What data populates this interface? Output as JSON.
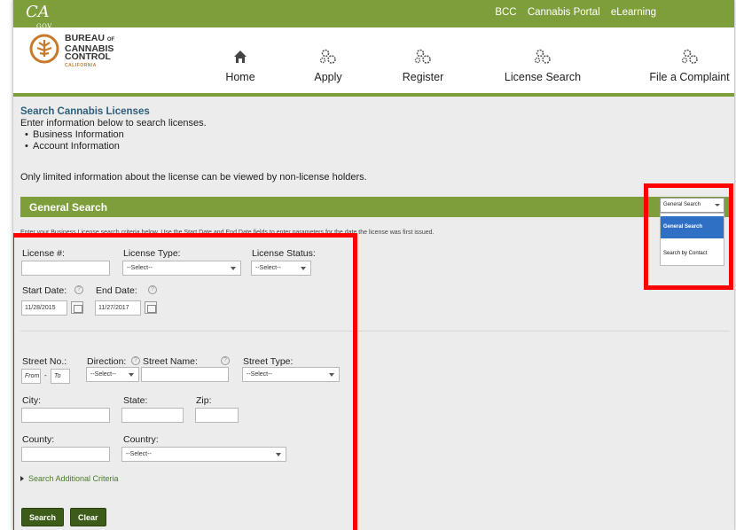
{
  "topbar": {
    "logo_text": "CA",
    "logo_sub": "GOV",
    "links": [
      "BCC",
      "Cannabis Portal",
      "eLearning"
    ]
  },
  "brand": {
    "line1": "BUREAU",
    "of": "OF",
    "line2": "CANNABIS",
    "line3": "CONTROL",
    "state": "CALIFORNIA"
  },
  "nav": [
    {
      "label": "Home",
      "icon": "home-icon"
    },
    {
      "label": "Apply",
      "icon": "gears-icon"
    },
    {
      "label": "Register",
      "icon": "gears-icon"
    },
    {
      "label": "License Search",
      "icon": "gears-icon"
    },
    {
      "label": "File a Complaint",
      "icon": "gears-icon"
    }
  ],
  "intro": {
    "title": "Search Cannabis Licenses",
    "text": "Enter information below to search licenses.",
    "bullets": [
      "Business Information",
      "Account Information"
    ],
    "notice": "Only limited information about the license can be viewed by non-license holders."
  },
  "general_search": {
    "title": "General Search",
    "subtitle": "Enter your Business License search criteria below.  Use the Start Date and End Date fields to enter parameters for the date the license was first issued."
  },
  "search_mode": {
    "selected": "General Search",
    "options": [
      "General Search",
      "Search by Contact"
    ]
  },
  "form": {
    "license_no_label": "License #:",
    "license_type_label": "License Type:",
    "license_type_value": "--Select--",
    "license_status_label": "License Status:",
    "license_status_value": "--Select--",
    "start_date_label": "Start Date:",
    "start_date_value": "11/28/2015",
    "end_date_label": "End Date:",
    "end_date_value": "11/27/2017",
    "street_no_label": "Street No.:",
    "street_from_placeholder": "From",
    "street_dash": "-",
    "street_to_placeholder": "To",
    "direction_label": "Direction:",
    "direction_value": "--Select--",
    "street_name_label": "Street Name:",
    "street_type_label": "Street Type:",
    "street_type_value": "--Select--",
    "city_label": "City:",
    "state_label": "State:",
    "zip_label": "Zip:",
    "county_label": "County:",
    "country_label": "Country:",
    "country_value": "--Select--",
    "more_criteria": "Search Additional Criteria",
    "search_button": "Search",
    "clear_button": "Clear",
    "help_glyph": "?"
  },
  "colors": {
    "brand_green": "#7d9e3a",
    "button_green": "#3d5c1a",
    "highlight_red": "#ff0000",
    "dropdown_active": "#2f6fc4",
    "title_blue": "#2d5f7d"
  }
}
